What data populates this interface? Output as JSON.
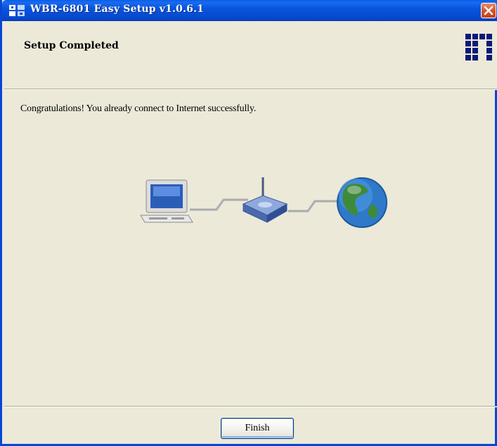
{
  "window": {
    "title": "WBR-6801 Easy Setup v1.0.6.1"
  },
  "header": {
    "title": "Setup Completed",
    "logo_icon": "brand-logo-icon"
  },
  "main": {
    "message": "Congratulations! You already connect to Internet successfully.",
    "diagram_icons": [
      "computer-icon",
      "router-icon",
      "globe-icon"
    ]
  },
  "footer": {
    "finish_label": "Finish"
  },
  "colors": {
    "titlebar": "#0855dd",
    "window_bg": "#ece9d8",
    "close_button": "#d9552c"
  }
}
